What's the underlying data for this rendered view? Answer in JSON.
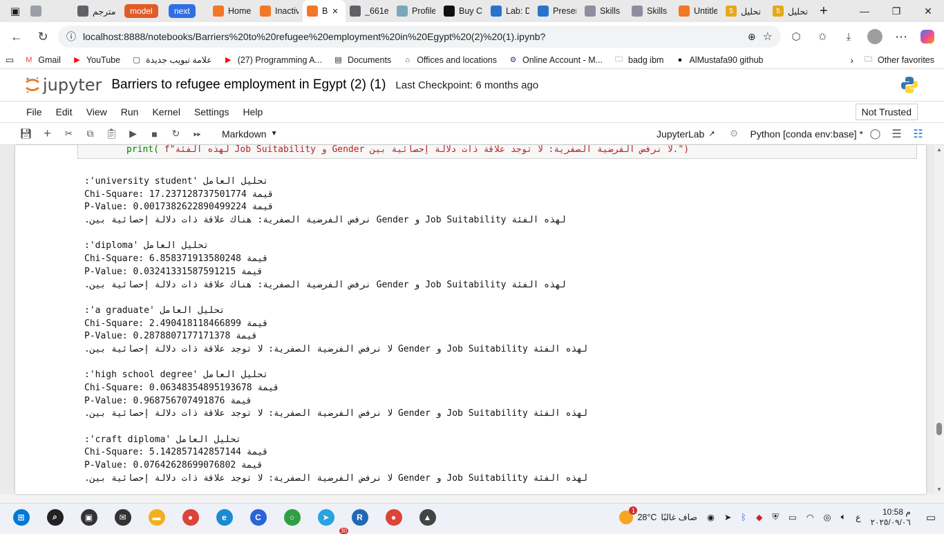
{
  "browser": {
    "tabs": [
      {
        "label": "",
        "icon": "settings-icon",
        "color": "#9aa0a6",
        "active": false
      },
      {
        "label": "مترجم",
        "icon": "search-icon",
        "color": "#5f6368",
        "active": false
      },
      {
        "label": "model",
        "icon": "",
        "color": "#e05b2a",
        "active": false,
        "pill": true
      },
      {
        "label": "next",
        "icon": "",
        "color": "#2f6fe4",
        "active": false,
        "pill": true
      },
      {
        "label": "Home",
        "icon": "jupyter-icon",
        "color": "#f37726",
        "active": false
      },
      {
        "label": "Inactiv",
        "icon": "notebook-icon",
        "color": "#f37726",
        "active": false
      },
      {
        "label": "B",
        "icon": "notebook-icon",
        "color": "#f37726",
        "active": true
      },
      {
        "label": "_661e",
        "icon": "globe-icon",
        "color": "#5f6368",
        "active": false
      },
      {
        "label": "Profile",
        "icon": "profile-icon",
        "color": "#7aa7b8",
        "active": false
      },
      {
        "label": "Buy C",
        "icon": "upwork-icon",
        "color": "#111111",
        "active": false
      },
      {
        "label": "Lab: D",
        "icon": "coursera-icon",
        "color": "#2a73cc",
        "active": false
      },
      {
        "label": "Preser",
        "icon": "coursera-icon",
        "color": "#2a73cc",
        "active": false
      },
      {
        "label": "Skills",
        "icon": "skills-icon",
        "color": "#8e8ea0",
        "active": false
      },
      {
        "label": "Skills",
        "icon": "skills-icon",
        "color": "#8e8ea0",
        "active": false
      },
      {
        "label": "Untitle",
        "icon": "notebook-icon",
        "color": "#f37726",
        "active": false
      },
      {
        "label": "تحليل",
        "icon": "5",
        "color": "#e6a817",
        "active": false
      },
      {
        "label": "تحليل",
        "icon": "5",
        "color": "#e6a817",
        "active": false
      }
    ],
    "close_glyph": "✕",
    "new_tab_glyph": "+",
    "url": "localhost:8888/notebooks/Barriers%20to%20refugee%20employment%20in%20Egypt%20(2)%20(1).ipynb?",
    "bookmarks": [
      {
        "label": "Gmail",
        "icon": "gmail-icon",
        "color": "#ea4335"
      },
      {
        "label": "YouTube",
        "icon": "youtube-icon",
        "color": "#ff0000"
      },
      {
        "label": "علامة تبويب جديدة",
        "icon": "page-icon",
        "color": "#333333"
      },
      {
        "label": "(27) Programming A...",
        "icon": "youtube-icon",
        "color": "#ff0000"
      },
      {
        "label": "Documents",
        "icon": "docs-icon",
        "color": "#222222"
      },
      {
        "label": "Offices and locations",
        "icon": "offices-icon",
        "color": "#444444"
      },
      {
        "label": "Online Account - M...",
        "icon": "gear-icon",
        "color": "#1f3f77"
      },
      {
        "label": "badg  ibm",
        "icon": "folder-icon",
        "color": "#444444"
      },
      {
        "label": "AlMustafa90 github",
        "icon": "github-icon",
        "color": "#111111"
      }
    ],
    "other_favorites": "Other favorites"
  },
  "jupyter": {
    "logo_text": "jupyter",
    "notebook_title": "Barriers to refugee employment in Egypt (2) (1)",
    "checkpoint": "Last Checkpoint: 6 months ago",
    "menu": [
      "File",
      "Edit",
      "View",
      "Run",
      "Kernel",
      "Settings",
      "Help"
    ],
    "trusted": "Not Trusted",
    "cell_type": "Markdown",
    "jupyterlab_link": "JupyterLab",
    "kernel_name": "Python [conda env:base] *"
  },
  "code_cell": {
    "fn": "print(",
    "str": "f\"لهذه الفئة Job Suitability و Gender لا نرفض الفرضية الصفرية: لا توجد علاقة ذات دلالة إحصائية بين.\")"
  },
  "output": [
    {
      "header": "تحليل العامل 'university student':",
      "chi": "قيمة Chi-Square: 17.237128737501774",
      "p": "قيمة P-Value: 0.0017382622890499224",
      "conclusion": "لهذه الفئة Job Suitability و Gender نرفض الفرضية الصفرية: هناك علاقة ذات دلالة إحصائية بين."
    },
    {
      "header": "تحليل العامل 'diploma':",
      "chi": "قيمة Chi-Square: 6.858371913580248",
      "p": "قيمة P-Value: 0.03241331587591215",
      "conclusion": "لهذه الفئة Job Suitability و Gender نرفض الفرضية الصفرية: هناك علاقة ذات دلالة إحصائية بين."
    },
    {
      "header": "تحليل العامل 'a graduate':",
      "chi": "قيمة Chi-Square: 2.490418118466899",
      "p": "قيمة P-Value: 0.2878807177171378",
      "conclusion": "لهذه الفئة Job Suitability و Gender لا نرفض الفرضية الصفرية: لا توجد علاقة ذات دلالة إحصائية بين."
    },
    {
      "header": "تحليل العامل 'high school degree':",
      "chi": "قيمة Chi-Square: 0.06348354895193678",
      "p": "قيمة P-Value: 0.968756707491876",
      "conclusion": "لهذه الفئة Job Suitability و Gender لا نرفض الفرضية الصفرية: لا توجد علاقة ذات دلالة إحصائية بين."
    },
    {
      "header": "تحليل العامل 'craft diploma':",
      "chi": "قيمة Chi-Square: 5.142857142857144",
      "p": "قيمة P-Value: 0.07642628699076802",
      "conclusion": "لهذه الفئة Job Suitability و Gender لا نرفض الفرضية الصفرية: لا توجد علاقة ذات دلالة إحصائية بين."
    }
  ],
  "taskbar": {
    "apps": [
      {
        "name": "start",
        "glyph": "⊞",
        "color": "#0078d4"
      },
      {
        "name": "search",
        "glyph": "⌕",
        "color": "#222222"
      },
      {
        "name": "task-view",
        "glyph": "▣",
        "color": "#333333"
      },
      {
        "name": "mail",
        "glyph": "✉",
        "color": "#333333"
      },
      {
        "name": "file-explorer",
        "glyph": "▬",
        "color": "#f2b01e"
      },
      {
        "name": "chrome",
        "glyph": "●",
        "color": "#db4437"
      },
      {
        "name": "edge",
        "glyph": "e",
        "color": "#1b8ad3"
      },
      {
        "name": "copilot",
        "glyph": "C",
        "color": "#2b63d9"
      },
      {
        "name": "xbox",
        "glyph": "○",
        "color": "#2ea043"
      },
      {
        "name": "telegram",
        "glyph": "➤",
        "color": "#2aa3df"
      },
      {
        "name": "r-lang",
        "glyph": "R",
        "color": "#2468b4"
      },
      {
        "name": "chrome-2",
        "glyph": "●",
        "color": "#db4437"
      },
      {
        "name": "photos",
        "glyph": "▲",
        "color": "#444444"
      }
    ],
    "telegram_badge": "30",
    "weather_temp": "28°C",
    "weather_text": "صاف غالبًا",
    "weather_badge": "1",
    "lang": "ع",
    "time": "10:58 م",
    "date": "٢٠٢٥/٠٩/٠٦"
  }
}
